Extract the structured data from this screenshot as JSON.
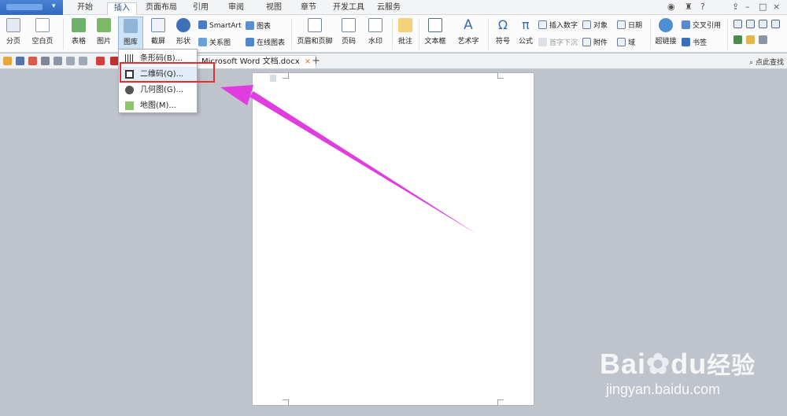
{
  "window": {
    "tabs": [
      {
        "label": "开始"
      },
      {
        "label": "插入"
      },
      {
        "label": "页面布局"
      },
      {
        "label": "引用"
      },
      {
        "label": "审阅"
      },
      {
        "label": "视图"
      },
      {
        "label": "章节"
      },
      {
        "label": "开发工具"
      },
      {
        "label": "云服务"
      }
    ],
    "right_items": [
      "?",
      "–",
      "□",
      "×"
    ]
  },
  "ribbon": {
    "page_break": "分页",
    "blank_page": "空白页",
    "table": "表格",
    "picture": "图片",
    "gallery": "图库",
    "screenshot": "截屏",
    "shape": "形状",
    "relation_chart": "关系图",
    "smartart": "SmartArt",
    "chart": "图表",
    "online_chart": "在线图表",
    "header_footer": "页眉和页脚",
    "page_number": "页码",
    "watermark": "水印",
    "comment": "批注",
    "textbox": "文本框",
    "wordart": "艺术字",
    "symbol": "符号",
    "formula": "公式",
    "insert_number": "插入数字",
    "object": "对象",
    "date": "日期",
    "first_drop": "首字下沉",
    "attachment": "附件",
    "field": "域",
    "hyperlink": "超链接",
    "cross_ref": "交叉引用",
    "bookmark": "书签"
  },
  "document": {
    "tab_title": "Microsoft Word 文档.docx",
    "close": "×",
    "plus": "+",
    "search": "点此查找"
  },
  "menu": {
    "items": [
      {
        "label": "条形码(B)..."
      },
      {
        "label": "二维码(Q)..."
      },
      {
        "label": "几何图(G)..."
      },
      {
        "label": "地图(M)..."
      }
    ]
  },
  "watermark": {
    "brand": "Bai",
    "brand2": "du",
    "brand_cn": "经验",
    "url": "jingyan.baidu.com"
  },
  "colors": {
    "accent": "#2f68bd",
    "highlight": "#e0302e",
    "arrow": "#e03ce0"
  }
}
